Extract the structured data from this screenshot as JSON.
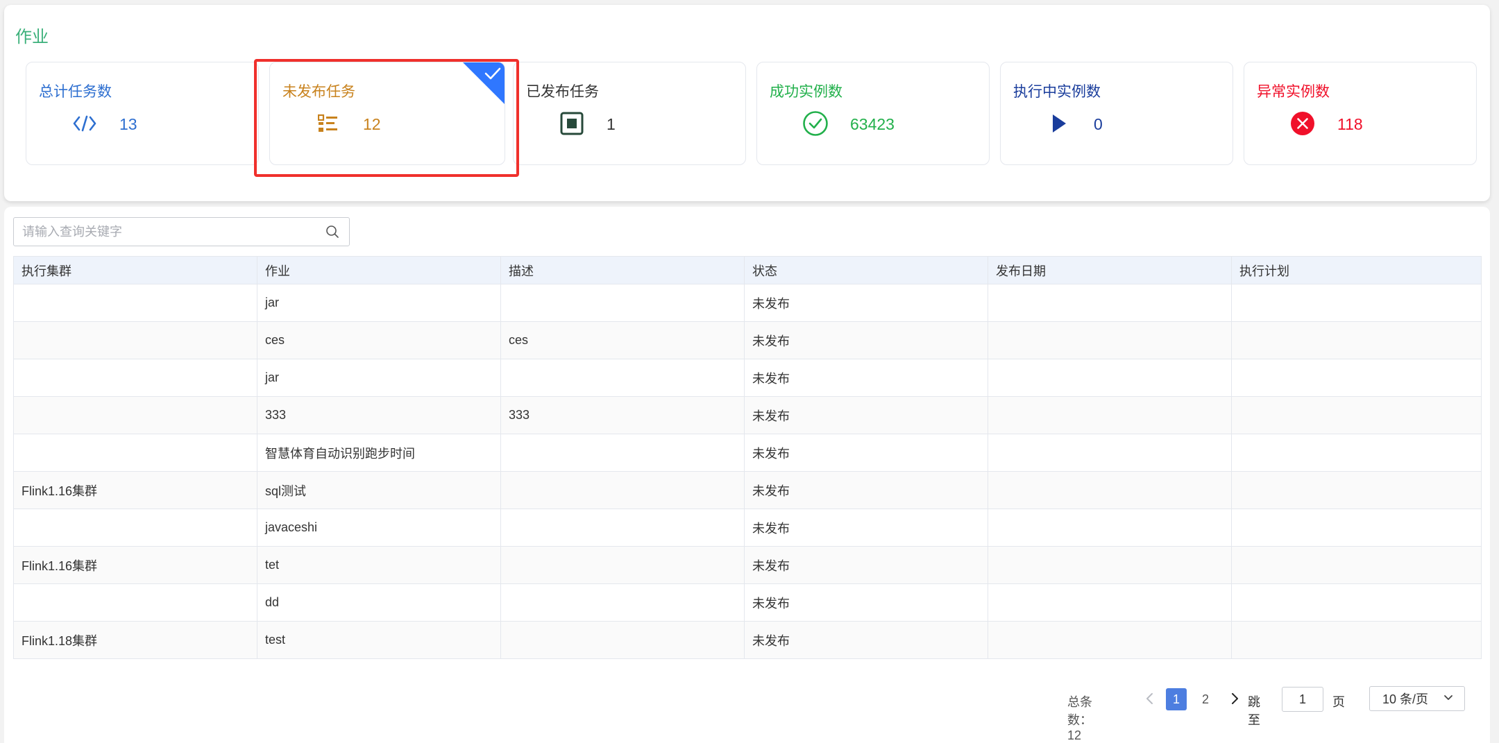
{
  "header": {
    "title": "作业"
  },
  "stats": [
    {
      "label": "总计任务数",
      "value": "13",
      "color": "#2e6fd0",
      "icon": "code-icon"
    },
    {
      "label": "未发布任务",
      "value": "12",
      "color": "#c8821d",
      "icon": "list-icon",
      "selected": true
    },
    {
      "label": "已发布任务",
      "value": "1",
      "color": "#333333",
      "icon": "stop-square-icon"
    },
    {
      "label": "成功实例数",
      "value": "63423",
      "color": "#22b04b",
      "icon": "check-circle-icon"
    },
    {
      "label": "执行中实例数",
      "value": "0",
      "color": "#1a3d9c",
      "icon": "play-icon"
    },
    {
      "label": "异常实例数",
      "value": "118",
      "color": "#f0102a",
      "icon": "error-circle-icon"
    }
  ],
  "search": {
    "placeholder": "请输入查询关键字",
    "value": ""
  },
  "table": {
    "columns": [
      "执行集群",
      "作业",
      "描述",
      "状态",
      "发布日期",
      "执行计划"
    ],
    "rows": [
      [
        "",
        "jar",
        "",
        "未发布",
        "",
        ""
      ],
      [
        "",
        "ces",
        "ces",
        "未发布",
        "",
        ""
      ],
      [
        "",
        "jar",
        "",
        "未发布",
        "",
        ""
      ],
      [
        "",
        "333",
        "333",
        "未发布",
        "",
        ""
      ],
      [
        "",
        "智慧体育自动识别跑步时间",
        "",
        "未发布",
        "",
        ""
      ],
      [
        "Flink1.16集群",
        "sql测试",
        "",
        "未发布",
        "",
        ""
      ],
      [
        "",
        "javaceshi",
        "",
        "未发布",
        "",
        ""
      ],
      [
        "Flink1.16集群",
        "tet",
        "",
        "未发布",
        "",
        ""
      ],
      [
        "",
        "dd",
        "",
        "未发布",
        "",
        ""
      ],
      [
        "Flink1.18集群",
        "test",
        "",
        "未发布",
        "",
        ""
      ]
    ]
  },
  "pager": {
    "total_label": "总条数：12",
    "pages": [
      "1",
      "2"
    ],
    "current_page": "1",
    "goto_label": "跳至",
    "goto_value": "1",
    "page_suffix": "页",
    "page_size": "10 条/页"
  },
  "colors": {
    "accent": "#3bb07a",
    "status_link": "#2e7bd6",
    "selected_frame": "#f0302c",
    "corner_flag": "#2f77ff"
  }
}
